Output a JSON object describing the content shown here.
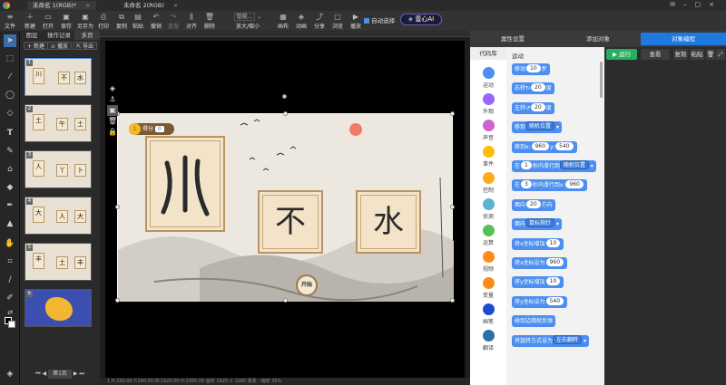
{
  "title_tabs": [
    {
      "label": "未命名 1(RGB)*",
      "active": true
    },
    {
      "label": "未命名 2(RGB)",
      "active": false
    }
  ],
  "toolbar": {
    "items": [
      "文件",
      "新建",
      "打开",
      "保存",
      "另存为",
      "打印",
      "复制",
      "粘贴",
      "撤销",
      "重做",
      "对齐",
      "删除",
      "放大/缩小",
      "画布",
      "动画",
      "分享",
      "浏览",
      "播放"
    ],
    "zoom_value": "智能...",
    "autoselect_label": "自动选择",
    "ai_label": "壹心AI"
  },
  "pages_panel": {
    "tabs": [
      "图层",
      "操作记录",
      "多页"
    ],
    "buttons": [
      "新建",
      "播放",
      "导出"
    ],
    "thumbs": [
      [
        "川",
        "不",
        "水"
      ],
      [
        "土",
        "午",
        "土"
      ],
      [
        "人",
        "丫",
        "卜"
      ],
      [
        "大",
        "人",
        "大"
      ],
      [
        "丰",
        "土",
        "丰"
      ],
      []
    ],
    "page_label": "第1页"
  },
  "stage": {
    "score_label": "得分",
    "score_value": "0",
    "cards": [
      "不",
      "水"
    ],
    "start_label": "开始"
  },
  "statusbar": "1 H:290.00 Y:140.00 W:1920.00 H:1080.00  画布 1920 × 1080 像素 · 缩放 35%",
  "right_panel": {
    "tabs": [
      "属性设置",
      "添加对象",
      "对象编程"
    ],
    "code_lib_label": "代码库",
    "categories": [
      {
        "name": "运动",
        "color": "#4c8ff0"
      },
      {
        "name": "外观",
        "color": "#9966ff"
      },
      {
        "name": "声音",
        "color": "#cf63cf"
      },
      {
        "name": "事件",
        "color": "#ffbf00"
      },
      {
        "name": "控制",
        "color": "#ffab19"
      },
      {
        "name": "侦测",
        "color": "#5cb1d6"
      },
      {
        "name": "运算",
        "color": "#59c059"
      },
      {
        "name": "视频",
        "color": "#ff8c1a"
      },
      {
        "name": "变量",
        "color": "#ff8c1a"
      },
      {
        "name": "画笔",
        "color": "#1f4ccf"
      },
      {
        "name": "翻译",
        "color": "#2e6fa8"
      }
    ],
    "section_title": "运动",
    "blocks": [
      {
        "t": "移动",
        "v": "10",
        "u": "步"
      },
      {
        "t": "右转",
        "v": "20",
        "u": "度",
        "ic": "↻"
      },
      {
        "t": "左转",
        "v": "20",
        "u": "度",
        "ic": "↺"
      },
      {
        "t": "移到",
        "d": "随机位置"
      },
      {
        "t": "移到x:",
        "v": "960",
        "t2": "y:",
        "v2": "540"
      },
      {
        "t": "在",
        "v": "1",
        "t2": "秒内滑行到",
        "d": "随机位置"
      },
      {
        "t": "在",
        "v": "3",
        "t2": "秒内滑行到x:",
        "v2": "960"
      },
      {
        "t": "面向",
        "v": "20",
        "u": "方向"
      },
      {
        "t": "面向",
        "d": "鼠标指针"
      },
      {
        "t": "将x坐标增加",
        "v": "10"
      },
      {
        "t": "将x坐标设为",
        "v": "960"
      },
      {
        "t": "将y坐标增加",
        "v": "10"
      },
      {
        "t": "将y坐标设为",
        "v": "540"
      },
      {
        "t": "碰到边缘就反弹"
      },
      {
        "t": "将旋转方式设为",
        "d": "左右翻转"
      }
    ],
    "script_buttons": [
      "运行",
      "查看",
      "复制",
      "粘贴"
    ]
  }
}
